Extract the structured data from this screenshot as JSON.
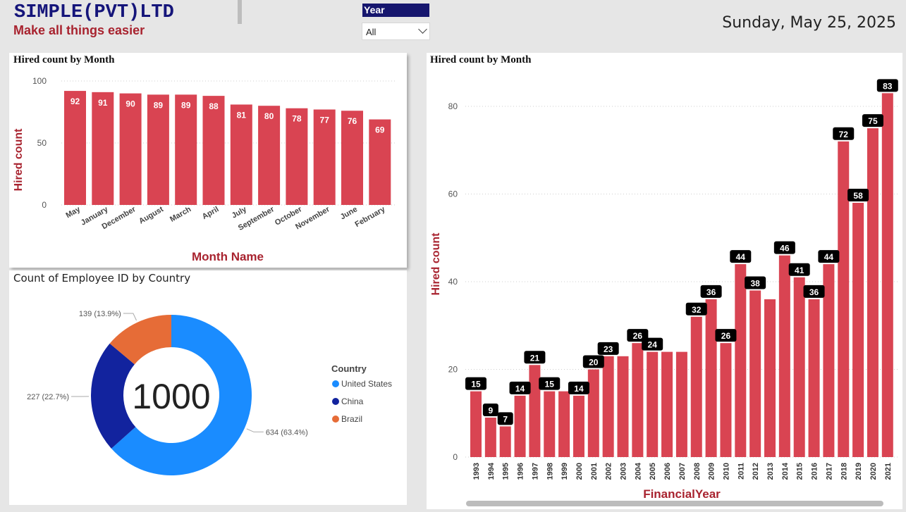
{
  "header": {
    "company": "SIMPLE(PVT)LTD",
    "tagline": "Make all things easier",
    "date": "Sunday, May 25, 2025"
  },
  "slicer": {
    "title": "Year",
    "value": "All"
  },
  "month_chart": {
    "title": "Hired count by Month",
    "ylabel": "Hired count",
    "xlabel": "Month Name",
    "yticks": [
      "0",
      "50",
      "100"
    ]
  },
  "country_chart": {
    "title": "Count of Employee ID by Country",
    "center_value": "1000",
    "legend_title": "Country",
    "labels": [
      "634 (63.4%)",
      "227 (22.7%)",
      "139 (13.9%)"
    ]
  },
  "year_chart": {
    "title": "Hired count by Month",
    "ylabel": "Hired count",
    "xlabel": "FinancialYear",
    "yticks": [
      "0",
      "20",
      "40",
      "60",
      "80"
    ]
  },
  "colors": {
    "bar": "#d94452",
    "united_states": "#1a8cff",
    "china": "#12239e",
    "brazil": "#e66c37",
    "title_navy": "#15157a",
    "accent_red": "#a8232f"
  },
  "chart_data": [
    {
      "type": "bar",
      "title": "Hired count by Month",
      "xlabel": "Month Name",
      "ylabel": "Hired count",
      "ylim": [
        0,
        100
      ],
      "categories": [
        "May",
        "January",
        "December",
        "August",
        "March",
        "April",
        "July",
        "September",
        "October",
        "November",
        "June",
        "February"
      ],
      "values": [
        92,
        91,
        90,
        89,
        89,
        88,
        81,
        80,
        78,
        77,
        76,
        69
      ]
    },
    {
      "type": "pie",
      "title": "Count of Employee ID by Country",
      "categories": [
        "United States",
        "China",
        "Brazil"
      ],
      "values": [
        634,
        227,
        139
      ],
      "total": 1000
    },
    {
      "type": "bar",
      "title": "Hired count by Month",
      "xlabel": "FinancialYear",
      "ylabel": "Hired count",
      "ylim": [
        0,
        85
      ],
      "categories": [
        "1993",
        "1994",
        "1995",
        "1996",
        "1997",
        "1998",
        "1999",
        "2000",
        "2001",
        "2002",
        "2003",
        "2004",
        "2005",
        "2006",
        "2007",
        "2008",
        "2009",
        "2010",
        "2011",
        "2012",
        "2013",
        "2014",
        "2015",
        "2016",
        "2017",
        "2018",
        "2019",
        "2020",
        "2021"
      ],
      "values": [
        15,
        9,
        7,
        14,
        21,
        15,
        15,
        14,
        20,
        23,
        23,
        26,
        24,
        24,
        24,
        32,
        36,
        26,
        44,
        38,
        36,
        46,
        41,
        36,
        44,
        72,
        58,
        75,
        83
      ],
      "labeled": [
        true,
        true,
        true,
        true,
        true,
        true,
        false,
        true,
        true,
        true,
        false,
        true,
        true,
        false,
        false,
        true,
        true,
        true,
        true,
        true,
        false,
        true,
        true,
        true,
        true,
        true,
        true,
        true,
        true
      ]
    }
  ]
}
